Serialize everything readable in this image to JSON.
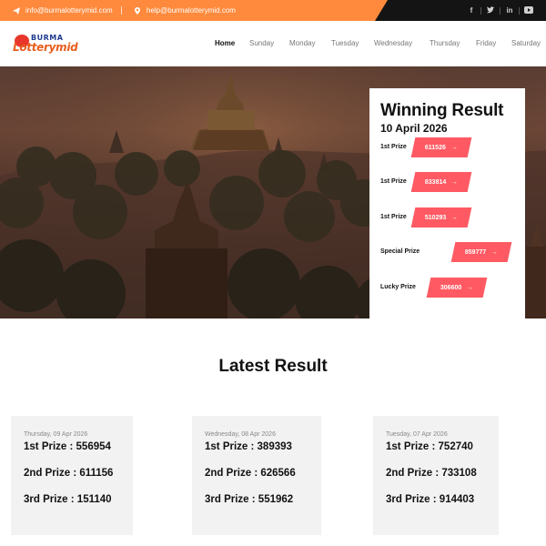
{
  "topbar": {
    "email": "info@burmalotterymid.com",
    "email2": "help@burmalotterymid.com",
    "socials": [
      {
        "icon": "facebook-icon",
        "glyph": "f"
      },
      {
        "icon": "twitter-icon",
        "glyph": "t"
      },
      {
        "icon": "linkedin-icon",
        "glyph": "in"
      },
      {
        "icon": "youtube-icon",
        "glyph": "▶"
      }
    ]
  },
  "logo": {
    "line1": "BURMA",
    "line2": "Lotterymid"
  },
  "nav": {
    "items": [
      "Home",
      "Sunday",
      "Monday",
      "Tuesday",
      "Wednesday",
      "Thursday",
      "Friday",
      "Saturday"
    ]
  },
  "winning": {
    "title": "Winning Result",
    "date": "10 April 2026",
    "prizes": [
      {
        "label": "1st Prize",
        "value": "611526"
      },
      {
        "label": "1st Prize",
        "value": "833814"
      },
      {
        "label": "1st Prize",
        "value": "510293"
      },
      {
        "label": "Special Prize",
        "value": "859777"
      },
      {
        "label": "Lucky Prize",
        "value": "306600"
      }
    ]
  },
  "latest": {
    "title": "Latest Result",
    "cards": [
      {
        "date": "Thursday, 09 Apr 2026",
        "first": "1st Prize : 556954",
        "second": "2nd Prize : 611156",
        "third": "3rd Prize : 151140"
      },
      {
        "date": "Wednesday, 08 Apr 2026",
        "first": "1st Prize : 389393",
        "second": "2nd Prize : 626566",
        "third": "3rd Prize : 551962"
      },
      {
        "date": "Tuesday, 07 Apr 2026",
        "first": "1st Prize : 752740",
        "second": "2nd Prize : 733108",
        "third": "3rd Prize : 914403"
      }
    ]
  },
  "colors": {
    "accent": "#ff8a3d",
    "prize": "#ff5a63",
    "dark": "#141414"
  }
}
